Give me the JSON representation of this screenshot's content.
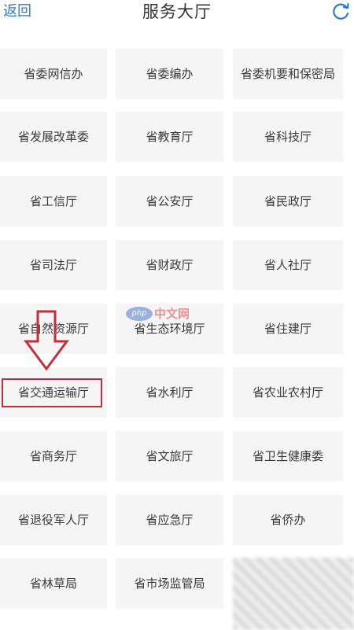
{
  "header": {
    "back_label": "返回",
    "title": "服务大厅",
    "refresh_icon": "refresh-icon"
  },
  "grid": {
    "rows": [
      [
        "省委网信办",
        "省委编办",
        "省委机要和保密局"
      ],
      [
        "省发展改革委",
        "省教育厅",
        "省科技厅"
      ],
      [
        "省工信厅",
        "省公安厅",
        "省民政厅"
      ],
      [
        "省司法厅",
        "省财政厅",
        "省人社厅"
      ],
      [
        "省自然资源厅",
        "省生态环境厅",
        "省住建厅"
      ],
      [
        "省交通运输厅",
        "省水利厅",
        "省农业农村厅"
      ],
      [
        "省商务厅",
        "省文旅厅",
        "省卫生健康委"
      ],
      [
        "省退役军人厅",
        "省应急厅",
        "省侨办"
      ],
      [
        "省林草局",
        "省市场监管局",
        ""
      ]
    ]
  },
  "highlight": {
    "target": "省交通运输厅",
    "color": "#c0303c"
  },
  "watermark": {
    "logo_text": "php",
    "text": "中文网"
  },
  "colors": {
    "accent": "#2f7ad1",
    "tile_bg": "#f5f5f5",
    "text": "#3a3a3a"
  }
}
